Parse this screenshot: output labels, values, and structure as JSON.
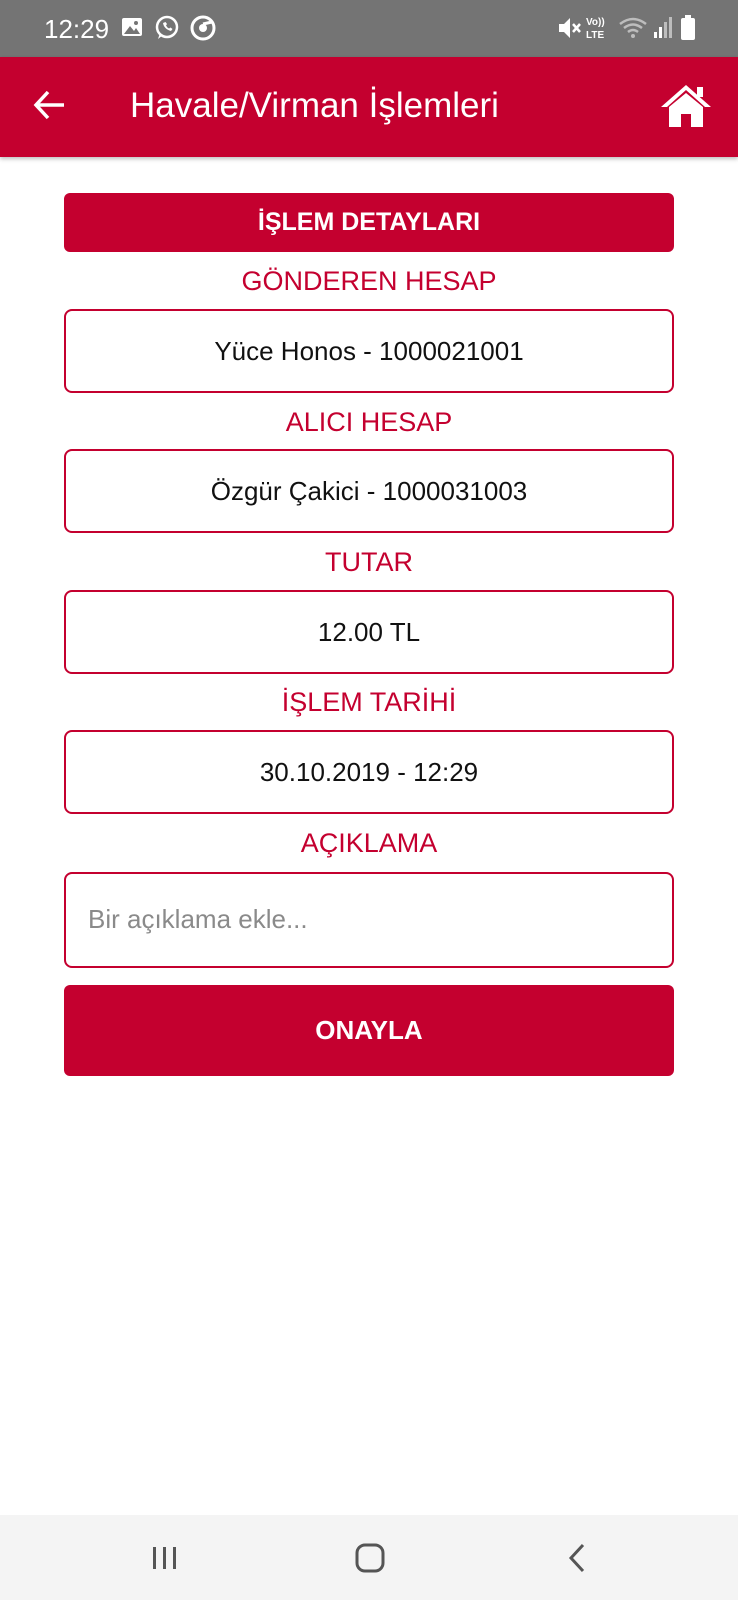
{
  "status_bar": {
    "time": "12:29",
    "icons": [
      "gallery-icon",
      "whatsapp-icon",
      "chrome-icon",
      "mute-icon",
      "volte-icon",
      "wifi-icon",
      "signal-icon",
      "battery-icon"
    ],
    "volte_text_top": "Vo))",
    "volte_text_bottom": "LTE"
  },
  "app_bar": {
    "title": "Havale/Virman İşlemleri",
    "back_icon": "arrow-back-icon",
    "home_icon": "home-icon",
    "color": "#c4002f"
  },
  "details": {
    "header": "İŞLEM DETAYLARI",
    "sender_label": "GÖNDEREN HESAP",
    "sender_value": "Yüce Honos - 1000021001",
    "receiver_label": "ALICI HESAP",
    "receiver_value": "Özgür Çakici - 1000031003",
    "amount_label": "TUTAR",
    "amount_value": "12.00 TL",
    "date_label": "İŞLEM TARİHİ",
    "date_value": "30.10.2019 - 12:29",
    "note_label": "AÇIKLAMA",
    "note_value": "",
    "note_placeholder": "Bir açıklama ekle..."
  },
  "confirm_button": "ONAYLA",
  "nav_bar": {
    "icons": [
      "recent-apps-icon",
      "home-nav-icon",
      "back-nav-icon"
    ]
  }
}
